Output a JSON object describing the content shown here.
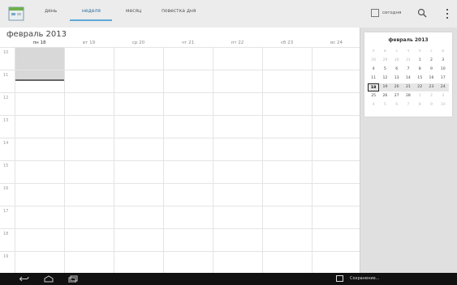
{
  "header": {
    "tabs": [
      {
        "label": "день",
        "active": false
      },
      {
        "label": "неделя",
        "active": true
      },
      {
        "label": "месяц",
        "active": false
      },
      {
        "label": "повестка дня",
        "active": false
      }
    ],
    "today_label": "сегодня",
    "icons": [
      "calendar-app-icon",
      "calendar-today-icon",
      "search-icon",
      "overflow-menu-icon"
    ]
  },
  "week": {
    "month_title": "февраль 2013",
    "days": [
      "пн 18",
      "вт 19",
      "ср 20",
      "чт 21",
      "пт 22",
      "сб 23",
      "вс 24"
    ],
    "hours": [
      "10",
      "11",
      "12",
      "13",
      "14",
      "15",
      "16",
      "17",
      "18",
      "19"
    ]
  },
  "minicalendar": {
    "title": "февраль 2013",
    "weekdays": [
      "п",
      "в",
      "с",
      "ч",
      "п",
      "с",
      "в"
    ],
    "weeks": [
      [
        [
          "28",
          true
        ],
        [
          "29",
          true
        ],
        [
          "30",
          true
        ],
        [
          "31",
          true
        ],
        [
          "1",
          false
        ],
        [
          "2",
          false
        ],
        [
          "3",
          false
        ]
      ],
      [
        [
          "4",
          false
        ],
        [
          "5",
          false
        ],
        [
          "6",
          false
        ],
        [
          "7",
          false
        ],
        [
          "8",
          false
        ],
        [
          "9",
          false
        ],
        [
          "10",
          false
        ]
      ],
      [
        [
          "11",
          false
        ],
        [
          "12",
          false
        ],
        [
          "13",
          false
        ],
        [
          "14",
          false
        ],
        [
          "15",
          false
        ],
        [
          "16",
          false
        ],
        [
          "17",
          false
        ]
      ],
      [
        [
          "18",
          false
        ],
        [
          "19",
          false
        ],
        [
          "20",
          false
        ],
        [
          "21",
          false
        ],
        [
          "22",
          false
        ],
        [
          "23",
          false
        ],
        [
          "24",
          false
        ]
      ],
      [
        [
          "25",
          false
        ],
        [
          "26",
          false
        ],
        [
          "27",
          false
        ],
        [
          "28",
          false
        ],
        [
          "1",
          true
        ],
        [
          "2",
          true
        ],
        [
          "3",
          true
        ]
      ],
      [
        [
          "4",
          true
        ],
        [
          "5",
          true
        ],
        [
          "6",
          true
        ],
        [
          "7",
          true
        ],
        [
          "8",
          true
        ],
        [
          "9",
          true
        ],
        [
          "10",
          true
        ]
      ]
    ],
    "today": "18"
  },
  "navbar": {
    "notification_text": "Сохранение...",
    "icons": [
      "back-icon",
      "home-icon",
      "recent-apps-icon",
      "screenshot-icon"
    ]
  },
  "colors": {
    "accent": "#5fa8d8",
    "navbar": "#111111"
  }
}
